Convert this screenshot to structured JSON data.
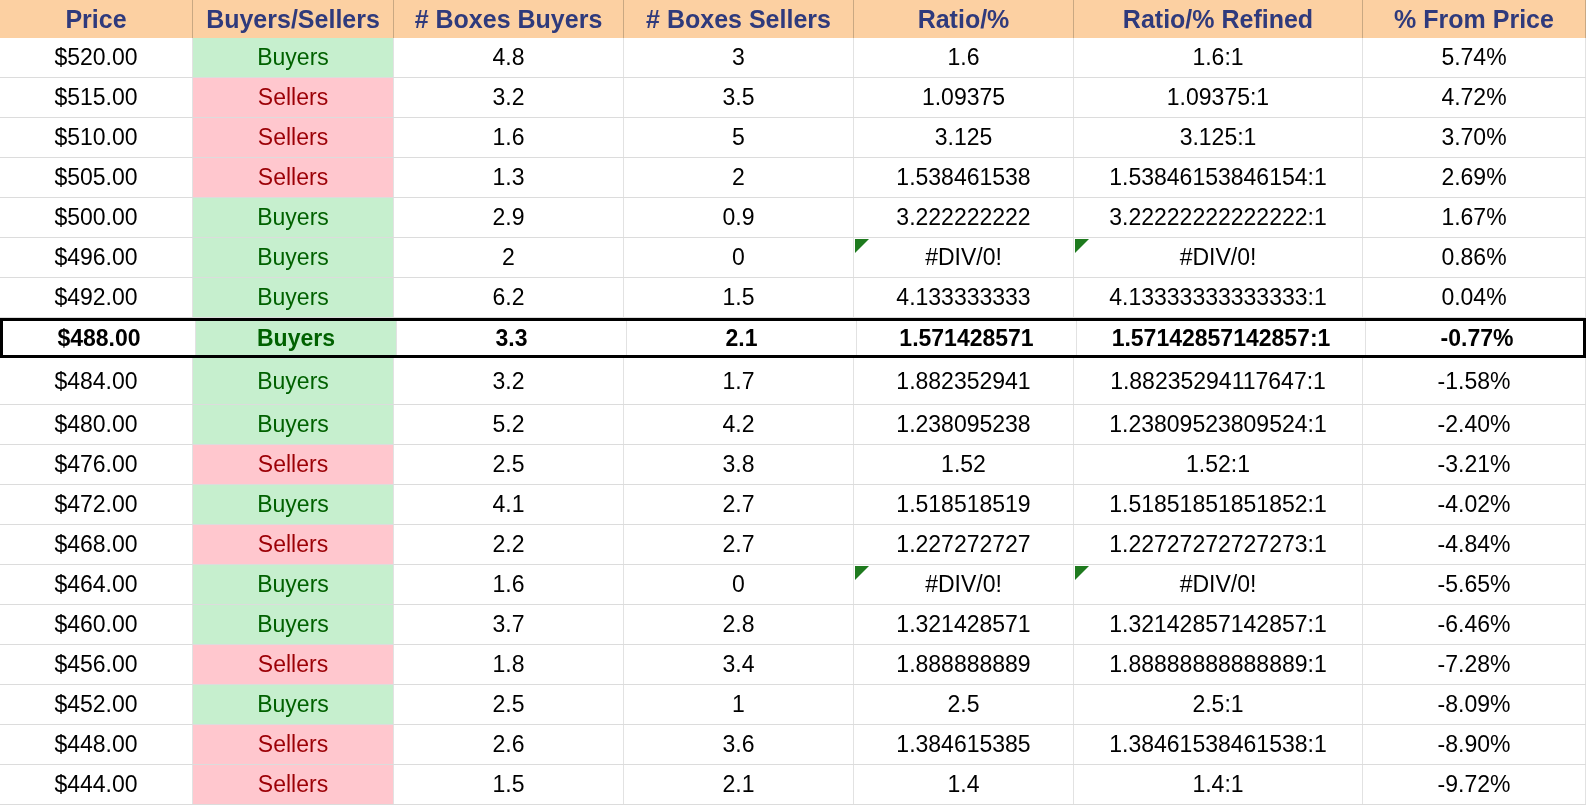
{
  "columns": [
    "Price",
    "Buyers/Sellers",
    "# Boxes Buyers",
    "# Boxes Sellers",
    "Ratio/%",
    "Ratio/% Refined",
    "% From Price"
  ],
  "rows": [
    {
      "price": "$520.00",
      "side": "Buyers",
      "kind": "buyers",
      "buyers": "4.8",
      "sellers": "3",
      "ratio": "1.6",
      "refined": "1.6:1",
      "from_price": "5.74%",
      "flagged": false,
      "selected": false
    },
    {
      "price": "$515.00",
      "side": "Sellers",
      "kind": "sellers",
      "buyers": "3.2",
      "sellers": "3.5",
      "ratio": "1.09375",
      "refined": "1.09375:1",
      "from_price": "4.72%",
      "flagged": false,
      "selected": false
    },
    {
      "price": "$510.00",
      "side": "Sellers",
      "kind": "sellers",
      "buyers": "1.6",
      "sellers": "5",
      "ratio": "3.125",
      "refined": "3.125:1",
      "from_price": "3.70%",
      "flagged": false,
      "selected": false
    },
    {
      "price": "$505.00",
      "side": "Sellers",
      "kind": "sellers",
      "buyers": "1.3",
      "sellers": "2",
      "ratio": "1.538461538",
      "refined": "1.53846153846154:1",
      "from_price": "2.69%",
      "flagged": false,
      "selected": false
    },
    {
      "price": "$500.00",
      "side": "Buyers",
      "kind": "buyers",
      "buyers": "2.9",
      "sellers": "0.9",
      "ratio": "3.222222222",
      "refined": "3.22222222222222:1",
      "from_price": "1.67%",
      "flagged": false,
      "selected": false
    },
    {
      "price": "$496.00",
      "side": "Buyers",
      "kind": "buyers",
      "buyers": "2",
      "sellers": "0",
      "ratio": "#DIV/0!",
      "refined": "#DIV/0!",
      "from_price": "0.86%",
      "flagged": true,
      "selected": false
    },
    {
      "price": "$492.00",
      "side": "Buyers",
      "kind": "buyers",
      "buyers": "6.2",
      "sellers": "1.5",
      "ratio": "4.133333333",
      "refined": "4.13333333333333:1",
      "from_price": "0.04%",
      "flagged": false,
      "selected": false
    },
    {
      "price": "$488.00",
      "side": "Buyers",
      "kind": "buyers",
      "buyers": "3.3",
      "sellers": "2.1",
      "ratio": "1.571428571",
      "refined": "1.57142857142857:1",
      "from_price": "-0.77%",
      "flagged": false,
      "selected": true
    },
    {
      "price": "$484.00",
      "side": "Buyers",
      "kind": "buyers",
      "buyers": "3.2",
      "sellers": "1.7",
      "ratio": "1.882352941",
      "refined": "1.88235294117647:1",
      "from_price": "-1.58%",
      "flagged": false,
      "selected": false
    },
    {
      "price": "$480.00",
      "side": "Buyers",
      "kind": "buyers",
      "buyers": "5.2",
      "sellers": "4.2",
      "ratio": "1.238095238",
      "refined": "1.23809523809524:1",
      "from_price": "-2.40%",
      "flagged": false,
      "selected": false
    },
    {
      "price": "$476.00",
      "side": "Sellers",
      "kind": "sellers",
      "buyers": "2.5",
      "sellers": "3.8",
      "ratio": "1.52",
      "refined": "1.52:1",
      "from_price": "-3.21%",
      "flagged": false,
      "selected": false
    },
    {
      "price": "$472.00",
      "side": "Buyers",
      "kind": "buyers",
      "buyers": "4.1",
      "sellers": "2.7",
      "ratio": "1.518518519",
      "refined": "1.51851851851852:1",
      "from_price": "-4.02%",
      "flagged": false,
      "selected": false
    },
    {
      "price": "$468.00",
      "side": "Sellers",
      "kind": "sellers",
      "buyers": "2.2",
      "sellers": "2.7",
      "ratio": "1.227272727",
      "refined": "1.22727272727273:1",
      "from_price": "-4.84%",
      "flagged": false,
      "selected": false
    },
    {
      "price": "$464.00",
      "side": "Buyers",
      "kind": "buyers",
      "buyers": "1.6",
      "sellers": "0",
      "ratio": "#DIV/0!",
      "refined": "#DIV/0!",
      "from_price": "-5.65%",
      "flagged": true,
      "selected": false
    },
    {
      "price": "$460.00",
      "side": "Buyers",
      "kind": "buyers",
      "buyers": "3.7",
      "sellers": "2.8",
      "ratio": "1.321428571",
      "refined": "1.32142857142857:1",
      "from_price": "-6.46%",
      "flagged": false,
      "selected": false
    },
    {
      "price": "$456.00",
      "side": "Sellers",
      "kind": "sellers",
      "buyers": "1.8",
      "sellers": "3.4",
      "ratio": "1.888888889",
      "refined": "1.88888888888889:1",
      "from_price": "-7.28%",
      "flagged": false,
      "selected": false
    },
    {
      "price": "$452.00",
      "side": "Buyers",
      "kind": "buyers",
      "buyers": "2.5",
      "sellers": "1",
      "ratio": "2.5",
      "refined": "2.5:1",
      "from_price": "-8.09%",
      "flagged": false,
      "selected": false
    },
    {
      "price": "$448.00",
      "side": "Sellers",
      "kind": "sellers",
      "buyers": "2.6",
      "sellers": "3.6",
      "ratio": "1.384615385",
      "refined": "1.38461538461538:1",
      "from_price": "-8.90%",
      "flagged": false,
      "selected": false
    },
    {
      "price": "$444.00",
      "side": "Sellers",
      "kind": "sellers",
      "buyers": "1.5",
      "sellers": "2.1",
      "ratio": "1.4",
      "refined": "1.4:1",
      "from_price": "-9.72%",
      "flagged": false,
      "selected": false
    }
  ]
}
